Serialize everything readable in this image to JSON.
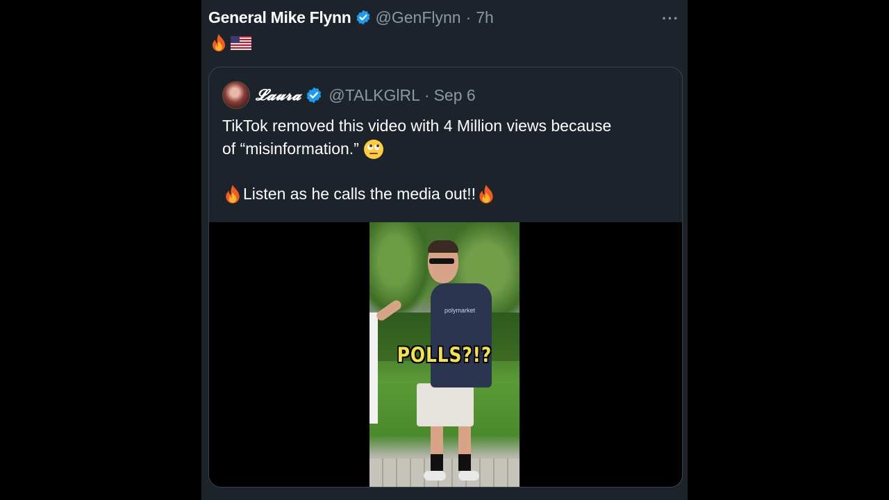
{
  "tweet": {
    "author_name": "General Mike Flynn",
    "handle": "@GenFlynn",
    "separator": "·",
    "time": "7h",
    "more_label": "···",
    "emojis": [
      "fire-emoji",
      "us-flag-emoji"
    ]
  },
  "quoted_tweet": {
    "author_name": "𝓛𝓪𝓾𝓻𝓪",
    "handle": "@TALKGlRL",
    "separator": "·",
    "date": "Sep 6",
    "text_line1": "TikTok removed this video with 4 Million views because",
    "text_line2": "of “misinformation.”",
    "text_line3": "Listen as he calls the media out!!",
    "video_caption": "POLLS?!?",
    "shirt_text": "polymarket"
  },
  "colors": {
    "background": "#000000",
    "card": "#1d232b",
    "verified": "#1d9bf0",
    "muted": "#8b98a5",
    "caption": "#f4e24a"
  }
}
